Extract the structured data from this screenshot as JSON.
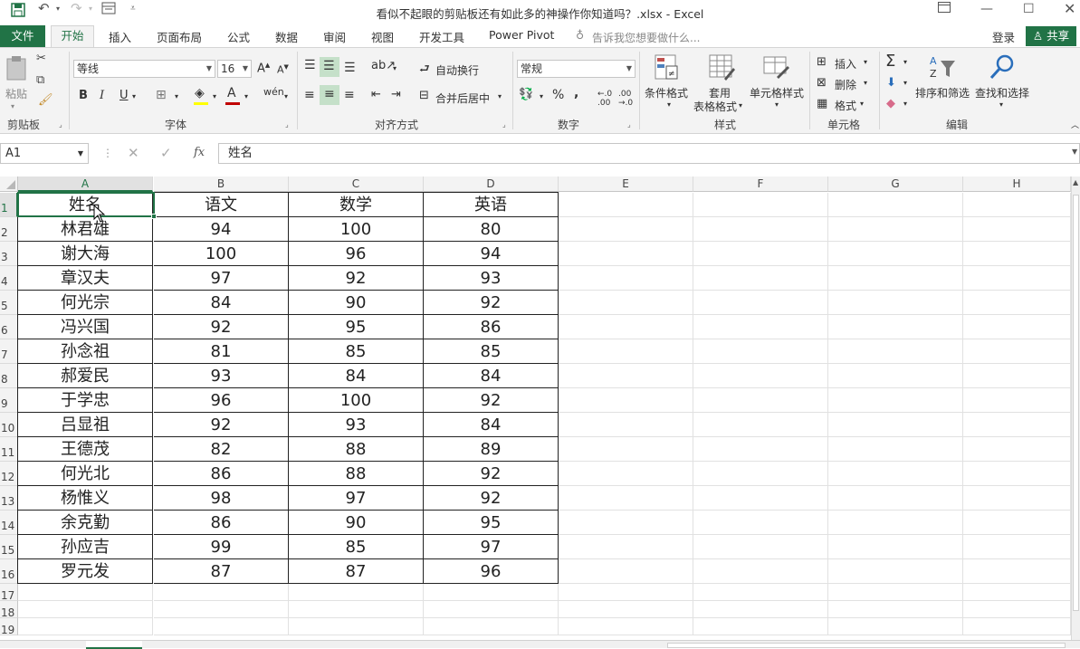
{
  "window": {
    "title": "看似不起眼的剪贴板还有如此多的神操作你知道吗？.xlsx - Excel"
  },
  "tabs": {
    "file": "文件",
    "home": "开始",
    "insert": "插入",
    "layout": "页面布局",
    "formulas": "公式",
    "data": "数据",
    "review": "审阅",
    "view": "视图",
    "developer": "开发工具",
    "powerpivot": "Power Pivot",
    "tellme": "告诉我您想要做什么...",
    "login": "登录",
    "share": "共享"
  },
  "ribbon": {
    "clipboard": {
      "paste": "粘贴",
      "label": "剪贴板"
    },
    "font": {
      "name": "等线",
      "size": "16",
      "label": "字体",
      "bold": "B",
      "italic": "I",
      "underline": "U"
    },
    "alignment": {
      "wrap": "自动换行",
      "merge": "合并后居中",
      "label": "对齐方式"
    },
    "number": {
      "format": "常规",
      "label": "数字",
      "percent": "%",
      "comma": ","
    },
    "styles": {
      "conditional": "条件格式",
      "table1": "套用",
      "table2": "表格格式",
      "cellstyles": "单元格样式",
      "label": "样式"
    },
    "cells": {
      "insert": "插入",
      "delete": "删除",
      "format": "格式",
      "label": "单元格"
    },
    "editing": {
      "sort": "排序和筛选",
      "find": "查找和选择",
      "label": "编辑"
    }
  },
  "formula_bar": {
    "name_box": "A1",
    "content": "姓名"
  },
  "sheet": {
    "columns": [
      "A",
      "B",
      "C",
      "D",
      "E",
      "F",
      "G",
      "H"
    ],
    "rows_count": 19,
    "data": [
      [
        "姓名",
        "语文",
        "数学",
        "英语"
      ],
      [
        "林君雄",
        "94",
        "100",
        "80"
      ],
      [
        "谢大海",
        "100",
        "96",
        "94"
      ],
      [
        "章汉夫",
        "97",
        "92",
        "93"
      ],
      [
        "何光宗",
        "84",
        "90",
        "92"
      ],
      [
        "冯兴国",
        "92",
        "95",
        "86"
      ],
      [
        "孙念祖",
        "81",
        "85",
        "85"
      ],
      [
        "郝爱民",
        "93",
        "84",
        "84"
      ],
      [
        "于学忠",
        "96",
        "100",
        "92"
      ],
      [
        "吕显祖",
        "92",
        "93",
        "84"
      ],
      [
        "王德茂",
        "82",
        "88",
        "89"
      ],
      [
        "何光北",
        "86",
        "88",
        "92"
      ],
      [
        "杨惟义",
        "98",
        "97",
        "92"
      ],
      [
        "余克勤",
        "86",
        "90",
        "95"
      ],
      [
        "孙应吉",
        "99",
        "85",
        "97"
      ],
      [
        "罗元发",
        "87",
        "87",
        "96"
      ]
    ]
  },
  "colors": {
    "accent": "#217346"
  }
}
